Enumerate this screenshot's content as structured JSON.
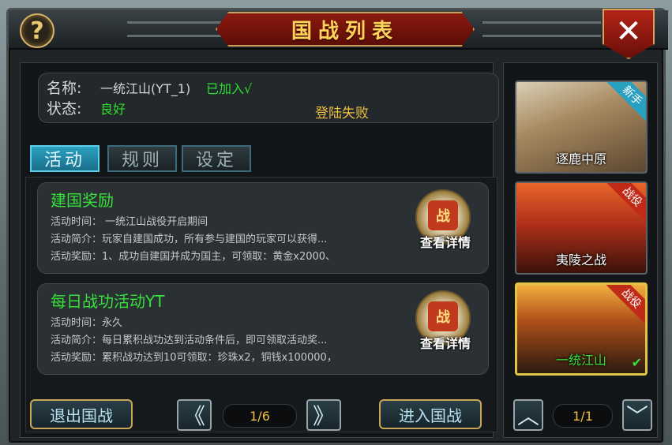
{
  "window": {
    "title": "国战列表",
    "help_label": "?",
    "close_label": "✕"
  },
  "info": {
    "name_label": "名称:",
    "name_value": "一统江山(YT_1)",
    "joined_text": "已加入√",
    "status_label": "状态:",
    "status_value": "良好",
    "login_status": "登陆失败"
  },
  "tabs": [
    {
      "label": "活动",
      "active": true
    },
    {
      "label": "规则",
      "active": false
    },
    {
      "label": "设定",
      "active": false
    }
  ],
  "activities": [
    {
      "title": "建国奖励",
      "time": "活动时间： 一统江山战役开启期间",
      "intro": "活动简介：玩家自建国成功，所有参与建国的玩家可以获得...",
      "reward": "活动奖励：1、成功自建国并成为国主，可领取：黄金x2000、",
      "badge_char": "战",
      "detail_label": "查看详情"
    },
    {
      "title": "每日战功活动YT",
      "time": "活动时间：永久",
      "intro": "活动简介：每日累积战功达到活动条件后，即可领取活动奖...",
      "reward": "活动奖励：累积战功达到10可领取：珍珠x2，铜钱x100000，",
      "badge_char": "战",
      "detail_label": "查看详情"
    }
  ],
  "footer": {
    "exit_label": "退出国战",
    "enter_label": "进入国战",
    "prev_icon": "《",
    "next_icon": "》",
    "page": "1/6"
  },
  "servers": [
    {
      "name": "逐鹿中原",
      "tag": "新手",
      "tag_color": "#2aa0c0",
      "selected": false
    },
    {
      "name": "夷陵之战",
      "tag": "战役",
      "tag_color": "#c22a18",
      "selected": false
    },
    {
      "name": "一统江山",
      "tag": "战役",
      "tag_color": "#c22a18",
      "selected": true,
      "check": "✔"
    }
  ],
  "server_pager": {
    "up_icon": "︿",
    "down_icon": "﹀",
    "page": "1/1"
  }
}
